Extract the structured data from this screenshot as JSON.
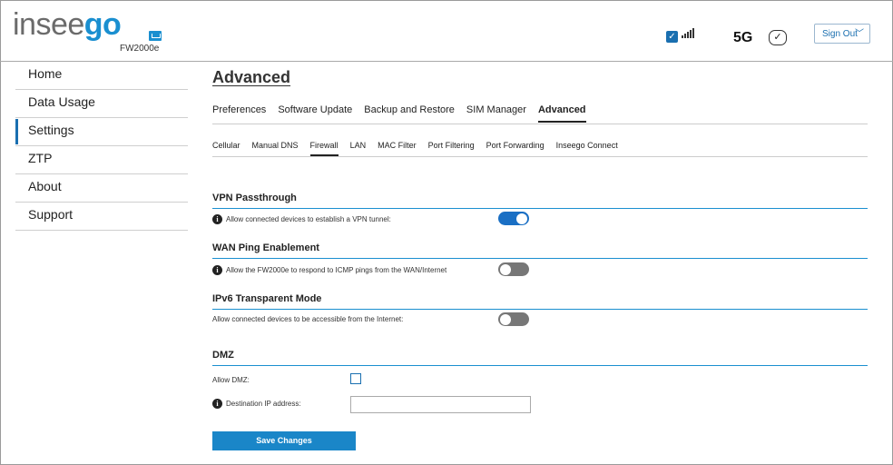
{
  "header": {
    "logo_part1": "insee",
    "logo_part2": "go",
    "model": "FW2000e",
    "network": "5G",
    "signout_label": "Sign Out",
    "signout_chevron": "﹀"
  },
  "icons": {
    "lan": "ethernet-icon",
    "wifi": "wifi-check-icon",
    "signal": "signal-bars-icon",
    "sim": "sim-check-icon",
    "info": "info-icon"
  },
  "colors": {
    "accent": "#1a86c8",
    "brand_blue": "#1a8fd0",
    "toggle_off": "#777777"
  },
  "sidebar": {
    "items": [
      {
        "label": "Home"
      },
      {
        "label": "Data Usage"
      },
      {
        "label": "Settings",
        "active": true
      },
      {
        "label": "ZTP"
      },
      {
        "label": "About"
      },
      {
        "label": "Support"
      }
    ]
  },
  "main": {
    "title": "Advanced",
    "tabs": [
      "Preferences",
      "Software Update",
      "Backup and Restore",
      "SIM Manager",
      "Advanced"
    ],
    "active_tab": "Advanced",
    "subtabs": [
      "Cellular",
      "Manual DNS",
      "Firewall",
      "LAN",
      "MAC Filter",
      "Port Filtering",
      "Port Forwarding",
      "Inseego Connect"
    ],
    "active_subtab": "Firewall",
    "vpn": {
      "title": "VPN Passthrough",
      "label": "Allow connected devices to establish a VPN tunnel:",
      "enabled": true
    },
    "wan_ping": {
      "title": "WAN Ping Enablement",
      "label": "Allow the FW2000e to respond to ICMP pings from the WAN/Internet",
      "enabled": false
    },
    "ipv6": {
      "title": "IPv6 Transparent Mode",
      "label": "Allow connected devices to be accessible from the Internet:",
      "enabled": false
    },
    "dmz": {
      "title": "DMZ",
      "allow_label": "Allow DMZ:",
      "allow_checked": false,
      "ip_label": "Destination IP address:",
      "ip_value": ""
    },
    "save_label": "Save Changes"
  }
}
